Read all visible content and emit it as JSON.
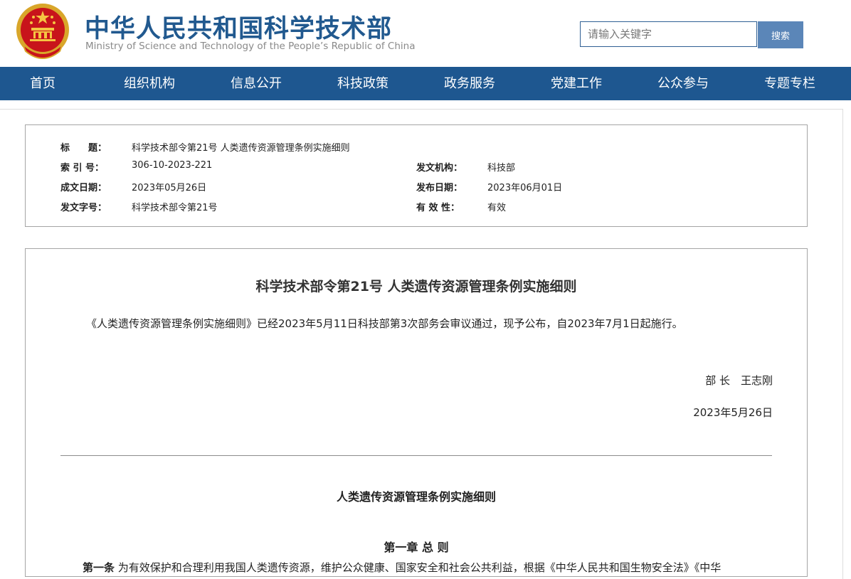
{
  "header": {
    "title": "中华人民共和国科学技术部",
    "subtitle": "Ministry of Science and Technology of the People’s Republic of China",
    "emblem_icon": "national-emblem-icon",
    "search": {
      "placeholder": "请输入关键字",
      "button_label": "搜索"
    },
    "colors": {
      "title": "#21598f",
      "search_button": "#5b86b8"
    }
  },
  "nav": {
    "color": "#1e5790",
    "items": [
      {
        "label": "首页"
      },
      {
        "label": "组织机构"
      },
      {
        "label": "信息公开"
      },
      {
        "label": "科技政策"
      },
      {
        "label": "政务服务"
      },
      {
        "label": "党建工作"
      },
      {
        "label": "公众参与"
      },
      {
        "label": "专题专栏"
      }
    ]
  },
  "meta": {
    "title_label": "标　　题：",
    "title_value": "科学技术部令第21号 人类遗传资源管理条例实施细则",
    "index_label": "索 引 号：",
    "index_value": "306-10-2023-221",
    "issuer_label": "发文机构：",
    "issuer_value": "科技部",
    "written_label": "成文日期：",
    "written_value": "2023年05月26日",
    "published_label": "发布日期：",
    "published_value": "2023年06月01日",
    "doc_no_label": "发文字号：",
    "doc_no_value": "科学技术部令第21号",
    "validity_label": "有 效 性：",
    "validity_value": "有效"
  },
  "article": {
    "title": "科学技术部令第21号 人类遗传资源管理条例实施细则",
    "intro": "《人类遗传资源管理条例实施细则》已经2023年5月11日科技部第3次部务会审议通过，现予公布，自2023年7月1日起施行。",
    "signer": "部 长　王志刚",
    "date": "2023年5月26日",
    "subtitle": "人类遗传资源管理条例实施细则",
    "chapter": "第一章 总 则",
    "article1_label": "第一条",
    "article1_text": "为有效保护和合理利用我国人类遗传资源，维护公众健康、国家安全和社会公共利益，根据《中华人民共和国生物安全法》《中华"
  }
}
